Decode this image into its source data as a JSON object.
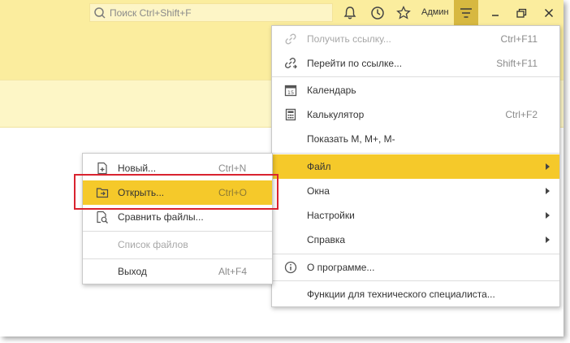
{
  "search": {
    "placeholder": "Поиск Ctrl+Shift+F",
    "icon": "search-icon"
  },
  "toolbar": {
    "notifications_icon": "bell-icon",
    "history_icon": "history-icon",
    "favorites_icon": "star-icon",
    "user": "Админ",
    "menu_icon": "hamburger-menu-icon"
  },
  "window_controls": {
    "minimize": "minimize-icon",
    "restore": "restore-icon",
    "close": "close-icon"
  },
  "colors": {
    "accent": "#f5c92a",
    "header": "#fbed9e",
    "highlight_frame": "#d9232f"
  },
  "main_menu": {
    "items": [
      {
        "label": "Получить ссылку...",
        "shortcut": "Ctrl+F11",
        "icon": "link-icon",
        "disabled": true
      },
      {
        "label": "Перейти по ссылке...",
        "shortcut": "Shift+F11",
        "icon": "goto-link-icon"
      },
      {
        "label": "Календарь",
        "shortcut": "",
        "icon": "calendar-icon"
      },
      {
        "label": "Калькулятор",
        "shortcut": "Ctrl+F2",
        "icon": "calculator-icon"
      },
      {
        "label": "Показать М, М+, М-",
        "shortcut": ""
      },
      {
        "label": "Файл",
        "submenu": true,
        "active": true
      },
      {
        "label": "Окна",
        "submenu": true
      },
      {
        "label": "Настройки",
        "submenu": true
      },
      {
        "label": "Справка",
        "submenu": true
      },
      {
        "label": "О программе...",
        "icon": "info-icon"
      },
      {
        "label": "Функции для технического специалиста..."
      }
    ]
  },
  "file_menu": {
    "items": [
      {
        "label": "Новый...",
        "shortcut": "Ctrl+N",
        "icon": "new-file-icon"
      },
      {
        "label": "Открыть...",
        "shortcut": "Ctrl+O",
        "icon": "open-folder-icon",
        "active": true
      },
      {
        "label": "Сравнить файлы...",
        "shortcut": "",
        "icon": "compare-files-icon"
      },
      {
        "label": "Список файлов",
        "shortcut": "",
        "disabled": true
      },
      {
        "label": "Выход",
        "shortcut": "Alt+F4"
      }
    ]
  }
}
